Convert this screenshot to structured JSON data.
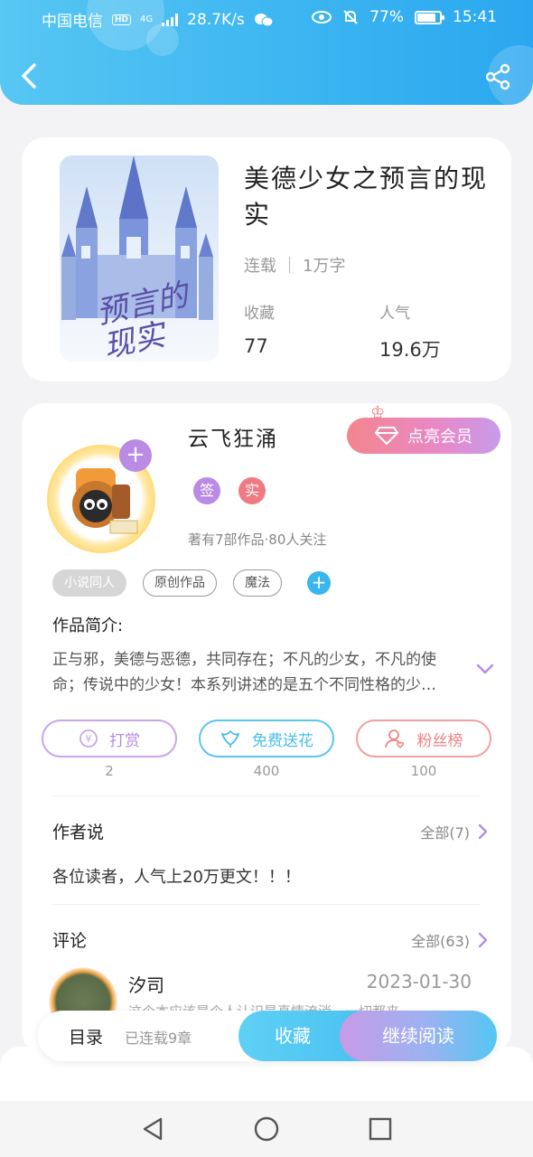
{
  "status_bar": {
    "carrier": "中国电信",
    "hd": "HD",
    "network": "4G",
    "speed": "28.7K/s",
    "battery": "77%",
    "battery_level": 0.77,
    "time": "15:41"
  },
  "book": {
    "cover_text": "预言的现实",
    "title": "美德少女之预言的现实",
    "status": "连载",
    "word_count": "1万字",
    "collect_label": "收藏",
    "collect_value": "77",
    "popularity_label": "人气",
    "popularity_value": "19.6万"
  },
  "author": {
    "name": "云飞狂涌",
    "vip_label": "点亮会员",
    "badge_signed": "签",
    "badge_real": "实",
    "stats": "著有7部作品·80人关注",
    "tags": [
      "小说同人",
      "原创作品",
      "魔法"
    ],
    "intro_label": "作品简介:",
    "intro_text": "正与邪，美德与恶德，共同存在；不凡的少女，不凡的使命；传说中的少女！本系列讲述的是五个不同性格的少女的故事……"
  },
  "actions": [
    {
      "label": "打赏",
      "count": "2",
      "color": "#b88ae0"
    },
    {
      "label": "免费送花",
      "count": "400",
      "color": "#47bfee"
    },
    {
      "label": "粉丝榜",
      "count": "100",
      "color": "#ee8486"
    }
  ],
  "author_says": {
    "title": "作者说",
    "more": "全部(7)",
    "text": "各位读者，人气上20万更文！！！"
  },
  "comments": {
    "title": "评论",
    "more": "全部(63)",
    "first": {
      "user": "汐司",
      "date": "2023-01-30",
      "text": "这个本应该是个人认识是真情流淌，一切都来"
    }
  },
  "bottom_bar": {
    "toc": "目录",
    "toc_status": "已连载9章",
    "collect": "收藏",
    "read": "继续阅读"
  },
  "colors": {
    "header": "#3fb7f1",
    "purple": "#b98be4",
    "pink": "#f07a83",
    "blue": "#3ab6ef"
  },
  "icons": [
    "back-icon",
    "share-icon",
    "expand-chevron-icon",
    "chevron-right-icon",
    "coin-icon",
    "flower-icon",
    "fans-icon",
    "diamond-icon",
    "nav-back-icon",
    "nav-home-icon",
    "nav-recent-icon"
  ]
}
